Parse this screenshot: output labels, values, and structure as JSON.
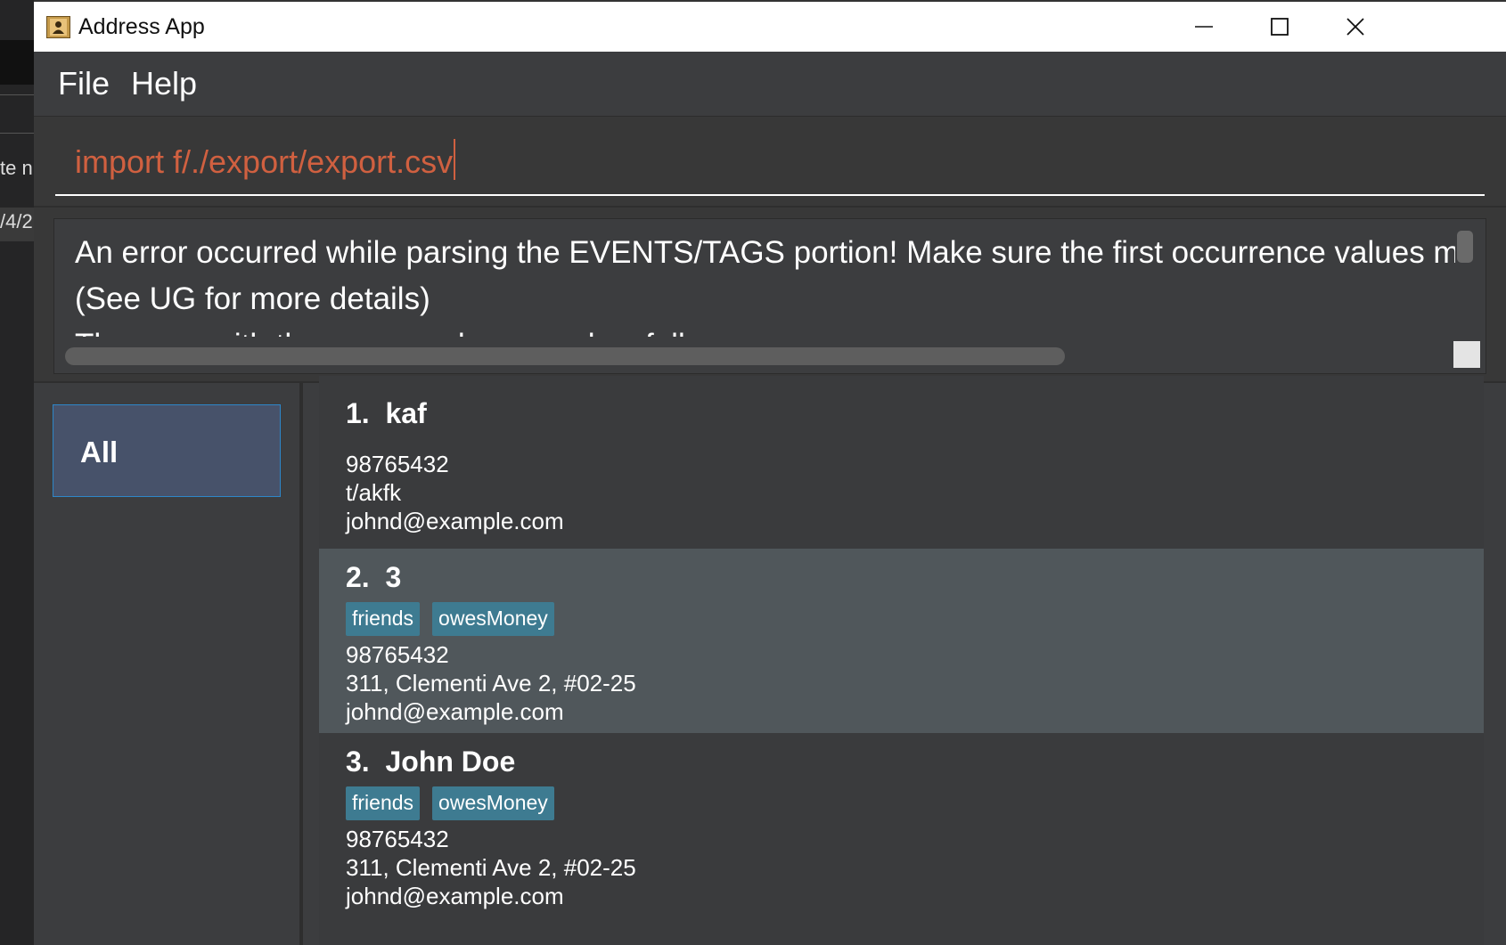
{
  "background_window": {
    "text_1": "te n",
    "text_2": "/4/2"
  },
  "window": {
    "title": "Address App",
    "icons": {
      "app": "address-book-icon",
      "minimize": "minimize-icon",
      "maximize": "maximize-icon",
      "close": "close-icon"
    }
  },
  "menu": {
    "file": "File",
    "help": "Help"
  },
  "command": {
    "value": "import f/./export/export.csv",
    "color": "#d06040"
  },
  "result": {
    "line1": "An error occurred while parsing the EVENTS/TAGS portion! Make sure the first occurrence values match the",
    "line2": "(See UG for more details)",
    "line3": "The error with the command occurred as follows:"
  },
  "sidebar": {
    "tab_all": "All"
  },
  "persons": [
    {
      "index": "1.",
      "name": "kaf",
      "tags": [],
      "phone": "98765432",
      "address": "t/akfk",
      "email": "johnd@example.com"
    },
    {
      "index": "2.",
      "name": "3",
      "tags": [
        "friends",
        "owesMoney"
      ],
      "phone": "98765432",
      "address": "311, Clementi Ave 2, #02-25",
      "email": "johnd@example.com"
    },
    {
      "index": "3.",
      "name": "John Doe",
      "tags": [
        "friends",
        "owesMoney"
      ],
      "phone": "98765432",
      "address": "311, Clementi Ave 2, #02-25",
      "email": "johnd@example.com"
    }
  ],
  "colors": {
    "tag": "#3e7b91",
    "selected_card": "#50575b",
    "tab_all": "#47526a"
  }
}
